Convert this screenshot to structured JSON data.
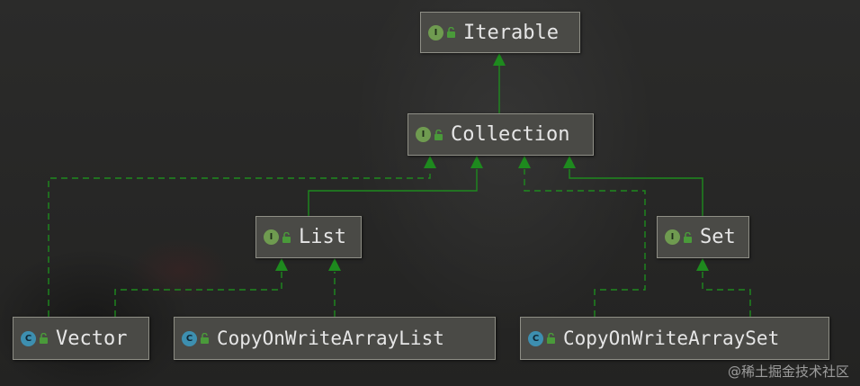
{
  "nodes": {
    "iterable": {
      "label": "Iterable",
      "kind": "I"
    },
    "collection": {
      "label": "Collection",
      "kind": "I"
    },
    "list": {
      "label": "List",
      "kind": "I"
    },
    "set": {
      "label": "Set",
      "kind": "I"
    },
    "vector": {
      "label": "Vector",
      "kind": "C"
    },
    "cowal": {
      "label": "CopyOnWriteArrayList",
      "kind": "C"
    },
    "cowas": {
      "label": "CopyOnWriteArraySet",
      "kind": "C"
    }
  },
  "colors": {
    "arrow": "#1e8a1e",
    "interface_badge": "#6f9b50",
    "class_badge": "#3d8fb0",
    "lock": "#4a9a3a"
  },
  "icons": {
    "interface": "interface-badge-icon",
    "class": "class-badge-icon",
    "visibility": "unlock-icon"
  },
  "watermark": "@稀土掘金技术社区"
}
